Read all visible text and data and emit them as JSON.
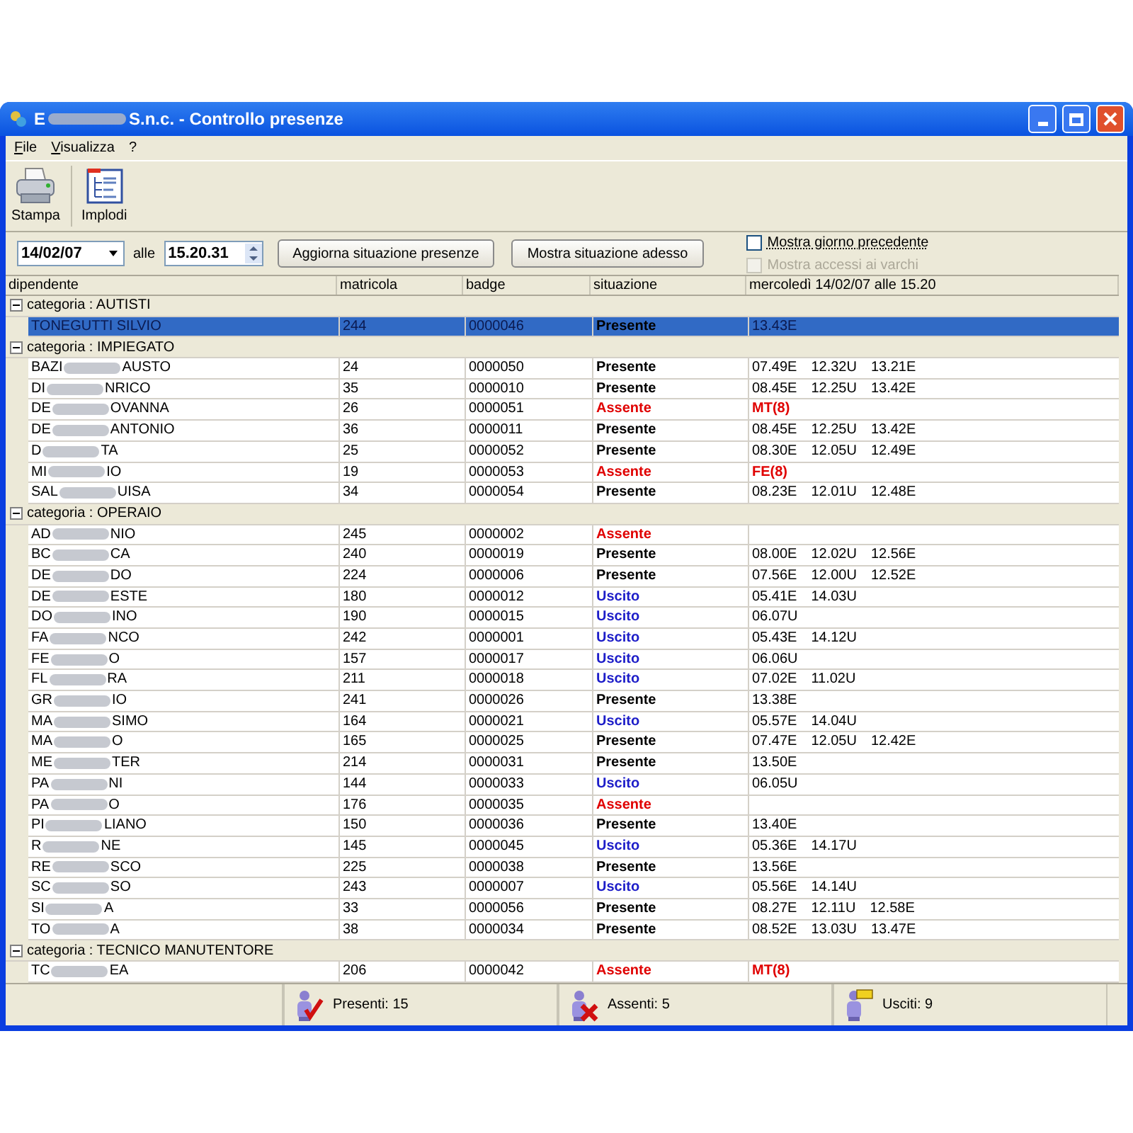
{
  "window": {
    "title_start": "E",
    "title_end": "S.n.c. - Controllo presenze"
  },
  "menu": [
    "File",
    "Visualizza",
    "?"
  ],
  "toolbar": [
    {
      "label": "Stampa",
      "kind": "print"
    },
    {
      "label": "Implodi",
      "kind": "collapse"
    }
  ],
  "filters": {
    "date": "14/02/07",
    "at_label": "alle",
    "time": "15.20.31",
    "buttons": [
      "Aggiorna situazione presenze",
      "Mostra situazione adesso"
    ],
    "checkboxes": [
      {
        "label": "Mostra giorno precedente",
        "checked": false,
        "disabled": false
      },
      {
        "label": "Mostra accessi ai varchi",
        "checked": false,
        "disabled": true
      }
    ]
  },
  "table": {
    "columns": [
      "dipendente",
      "matricola",
      "badge",
      "situazione",
      "mercoledì 14/02/07 alle 15.20"
    ],
    "groups": [
      {
        "label": "categoria : AUTISTI",
        "expanded": true,
        "rows": [
          {
            "name_start": "TONEGUTTI SILVIO",
            "matricola": "244",
            "badge": "0000046",
            "situazione": "Presente",
            "kind": "present",
            "times": [
              "13.43E"
            ],
            "selected": true
          }
        ]
      },
      {
        "label": "categoria : IMPIEGATO",
        "expanded": true,
        "rows": [
          {
            "name_start": "BAZI",
            "name_end": "AUSTO",
            "matricola": "24",
            "badge": "0000050",
            "situazione": "Presente",
            "kind": "present",
            "times": [
              "07.49E",
              "12.32U",
              "13.21E"
            ],
            "selected": false
          },
          {
            "name_start": "DI",
            "name_end": "NRICO",
            "matricola": "35",
            "badge": "0000010",
            "situazione": "Presente",
            "kind": "present",
            "times": [
              "08.45E",
              "12.25U",
              "13.42E"
            ],
            "selected": false
          },
          {
            "name_start": "DE",
            "name_end": "OVANNA",
            "matricola": "26",
            "badge": "0000051",
            "situazione": "Assente",
            "kind": "absent",
            "times": [
              "MT(8)"
            ],
            "selected": false
          },
          {
            "name_start": "DE",
            "name_end": "ANTONIO",
            "matricola": "36",
            "badge": "0000011",
            "situazione": "Presente",
            "kind": "present",
            "times": [
              "08.45E",
              "12.25U",
              "13.42E"
            ],
            "selected": false
          },
          {
            "name_start": "D",
            "name_end": "TA",
            "matricola": "25",
            "badge": "0000052",
            "situazione": "Presente",
            "kind": "present",
            "times": [
              "08.30E",
              "12.05U",
              "12.49E"
            ],
            "selected": false
          },
          {
            "name_start": "MI",
            "name_end": "IO",
            "matricola": "19",
            "badge": "0000053",
            "situazione": "Assente",
            "kind": "absent",
            "times": [
              "FE(8)"
            ],
            "selected": false
          },
          {
            "name_start": "SAL",
            "name_end": "UISA",
            "matricola": "34",
            "badge": "0000054",
            "situazione": "Presente",
            "kind": "present",
            "times": [
              "08.23E",
              "12.01U",
              "12.48E"
            ],
            "selected": false
          }
        ]
      },
      {
        "label": "categoria : OPERAIO",
        "expanded": true,
        "rows": [
          {
            "name_start": "AD",
            "name_end": "NIO",
            "matricola": "245",
            "badge": "0000002",
            "situazione": "Assente",
            "kind": "absent",
            "selected": false
          },
          {
            "name_start": "BC",
            "name_end": "CA",
            "matricola": "240",
            "badge": "0000019",
            "situazione": "Presente",
            "kind": "present",
            "times": [
              "08.00E",
              "12.02U",
              "12.56E"
            ],
            "selected": false
          },
          {
            "name_start": "DE",
            "name_end": "DO",
            "matricola": "224",
            "badge": "0000006",
            "situazione": "Presente",
            "kind": "present",
            "times": [
              "07.56E",
              "12.00U",
              "12.52E"
            ],
            "selected": false
          },
          {
            "name_start": "DE",
            "name_end": "ESTE",
            "matricola": "180",
            "badge": "0000012",
            "situazione": "Uscito",
            "kind": "out",
            "times": [
              "05.41E",
              "14.03U"
            ],
            "selected": false
          },
          {
            "name_start": "DO",
            "name_end": "INO",
            "matricola": "190",
            "badge": "0000015",
            "situazione": "Uscito",
            "kind": "out",
            "times": [
              "06.07U"
            ],
            "selected": false
          },
          {
            "name_start": "FA",
            "name_end": "NCO",
            "matricola": "242",
            "badge": "0000001",
            "situazione": "Uscito",
            "kind": "out",
            "times": [
              "05.43E",
              "14.12U"
            ],
            "selected": false
          },
          {
            "name_start": "FE",
            "name_end": "O",
            "matricola": "157",
            "badge": "0000017",
            "situazione": "Uscito",
            "kind": "out",
            "times": [
              "06.06U"
            ],
            "selected": false
          },
          {
            "name_start": "FL",
            "name_end": "RA",
            "matricola": "211",
            "badge": "0000018",
            "situazione": "Uscito",
            "kind": "out",
            "times": [
              "07.02E",
              "11.02U"
            ],
            "selected": false
          },
          {
            "name_start": "GR",
            "name_end": "IO",
            "matricola": "241",
            "badge": "0000026",
            "situazione": "Presente",
            "kind": "present",
            "times": [
              "13.38E"
            ],
            "selected": false
          },
          {
            "name_start": "MA",
            "name_end": "SIMO",
            "matricola": "164",
            "badge": "0000021",
            "situazione": "Uscito",
            "kind": "out",
            "times": [
              "05.57E",
              "14.04U"
            ],
            "selected": false
          },
          {
            "name_start": "MA",
            "name_end": "O",
            "matricola": "165",
            "badge": "0000025",
            "situazione": "Presente",
            "kind": "present",
            "times": [
              "07.47E",
              "12.05U",
              "12.42E"
            ],
            "selected": false
          },
          {
            "name_start": "ME",
            "name_end": "TER",
            "matricola": "214",
            "badge": "0000031",
            "situazione": "Presente",
            "kind": "present",
            "times": [
              "13.50E"
            ],
            "selected": false
          },
          {
            "name_start": "PA",
            "name_end": "NI",
            "matricola": "144",
            "badge": "0000033",
            "situazione": "Uscito",
            "kind": "out",
            "times": [
              "06.05U"
            ],
            "selected": false
          },
          {
            "name_start": "PA",
            "name_end": "O",
            "matricola": "176",
            "badge": "0000035",
            "situazione": "Assente",
            "kind": "absent",
            "selected": false
          },
          {
            "name_start": "PI",
            "name_end": "LIANO",
            "matricola": "150",
            "badge": "0000036",
            "situazione": "Presente",
            "kind": "present",
            "times": [
              "13.40E"
            ],
            "selected": false
          },
          {
            "name_start": "R",
            "name_end": "NE",
            "matricola": "145",
            "badge": "0000045",
            "situazione": "Uscito",
            "kind": "out",
            "times": [
              "05.36E",
              "14.17U"
            ],
            "selected": false
          },
          {
            "name_start": "RE",
            "name_end": "SCO",
            "matricola": "225",
            "badge": "0000038",
            "situazione": "Presente",
            "kind": "present",
            "times": [
              "13.56E"
            ],
            "selected": false
          },
          {
            "name_start": "SC",
            "name_end": "SO",
            "matricola": "243",
            "badge": "0000007",
            "situazione": "Uscito",
            "kind": "out",
            "times": [
              "05.56E",
              "14.14U"
            ],
            "selected": false
          },
          {
            "name_start": "SI",
            "name_end": "A",
            "matricola": "33",
            "badge": "0000056",
            "situazione": "Presente",
            "kind": "present",
            "times": [
              "08.27E",
              "12.11U",
              "12.58E"
            ],
            "selected": false
          },
          {
            "name_start": "TO",
            "name_end": "A",
            "matricola": "38",
            "badge": "0000034",
            "situazione": "Presente",
            "kind": "present",
            "times": [
              "08.52E",
              "13.03U",
              "13.47E"
            ],
            "selected": false
          }
        ]
      },
      {
        "label": "categoria : TECNICO MANUTENTORE",
        "expanded": true,
        "rows": [
          {
            "name_start": "TC",
            "name_end": "EA",
            "matricola": "206",
            "badge": "0000042",
            "situazione": "Assente",
            "kind": "absent",
            "times": [
              "MT(8)"
            ],
            "selected": false
          }
        ]
      }
    ]
  },
  "status_bar": [
    {
      "label": "Presenti: 15",
      "kind": "present"
    },
    {
      "label": "Assenti: 5",
      "kind": "absent"
    },
    {
      "label": "Usciti: 9",
      "kind": "out"
    }
  ]
}
